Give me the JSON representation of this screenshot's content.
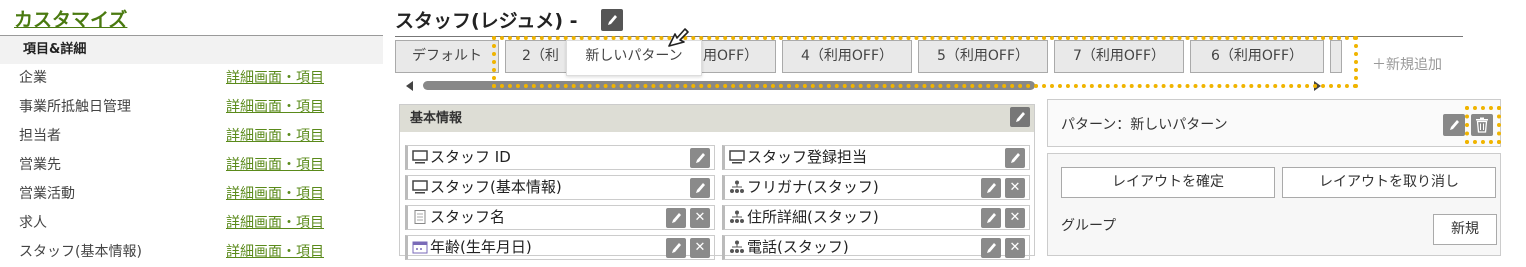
{
  "sidebar": {
    "title": "カスタマイズ",
    "section_header": "項目&詳細",
    "items": [
      {
        "name": "企業",
        "link": "詳細画面・項目"
      },
      {
        "name": "事業所抵触日管理",
        "link": "詳細画面・項目"
      },
      {
        "name": "担当者",
        "link": "詳細画面・項目"
      },
      {
        "name": "営業先",
        "link": "詳細画面・項目"
      },
      {
        "name": "営業活動",
        "link": "詳細画面・項目"
      },
      {
        "name": "求人",
        "link": "詳細画面・項目"
      },
      {
        "name": "スタッフ(基本情報)",
        "link": "詳細画面・項目"
      }
    ]
  },
  "header": {
    "title": "スタッフ(レジュメ) -"
  },
  "tabs": {
    "items": [
      "デフォルト",
      "2（利",
      "用OFF）",
      "4（利用OFF）",
      "5（利用OFF）",
      "7（利用OFF）",
      "6（利用OFF）"
    ],
    "dragging": "新しいパターン",
    "add_new": "＋新規追加"
  },
  "basic_info": {
    "title": "基本情報",
    "left_fields": [
      {
        "label": "スタッフ ID",
        "icon": "monitor-icon"
      },
      {
        "label": "スタッフ(基本情報)",
        "icon": "monitor-icon"
      },
      {
        "label": "スタッフ名",
        "icon": "document-icon"
      },
      {
        "label": "年齢(生年月日)",
        "icon": "calendar-icon"
      }
    ],
    "right_fields": [
      {
        "label": "スタッフ登録担当",
        "icon": "monitor-icon"
      },
      {
        "label": "フリガナ(スタッフ)",
        "icon": "hierarchy-icon"
      },
      {
        "label": "住所詳細(スタッフ)",
        "icon": "hierarchy-icon"
      },
      {
        "label": "電話(スタッフ)",
        "icon": "hierarchy-icon"
      }
    ]
  },
  "pattern_panel": {
    "label": "パターン：新しいパターン",
    "confirm_layout": "レイアウトを確定",
    "cancel_layout": "レイアウトを取り消し",
    "group_label": "グループ",
    "new_button": "新規"
  },
  "colors": {
    "accent_link": "#5a8a1a",
    "title_green": "#4a7a10",
    "highlight": "#f0b400"
  }
}
